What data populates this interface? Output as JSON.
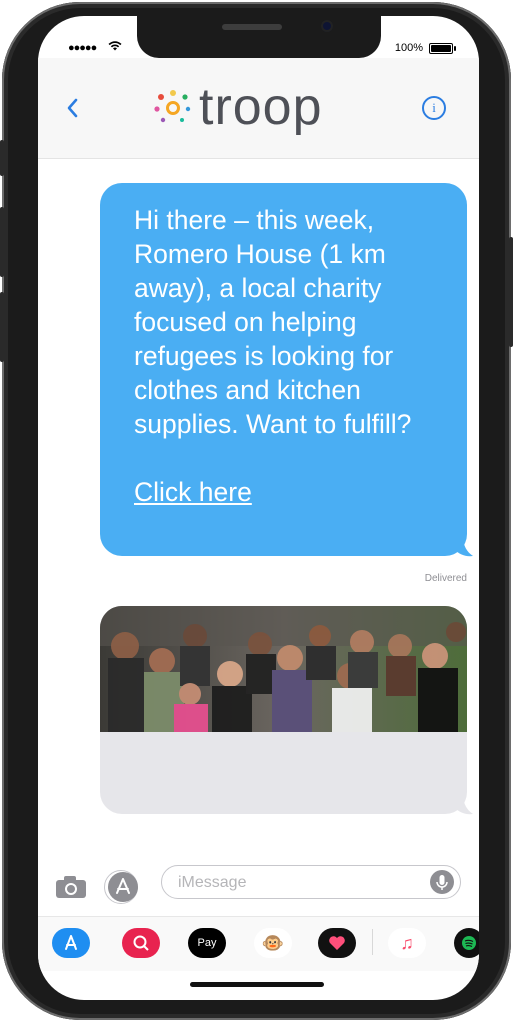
{
  "status_bar": {
    "signal": "●●●●●",
    "battery_percent": "100%"
  },
  "header": {
    "back_icon": "chevron-left-icon",
    "logo_text": "troop",
    "info_icon": "info-icon",
    "info_glyph": "i",
    "accent_color": "#2b7de1"
  },
  "messages": {
    "outgoing_text": "Hi there – this week, Romero House (1 km away), a local charity focused on helping refugees is looking for clothes and kitchen supplies. Want to fulfill?",
    "outgoing_link": "Click here",
    "bubble_color": "#4aaef3",
    "delivered_label": "Delivered"
  },
  "input": {
    "placeholder": "iMessage",
    "camera_icon": "camera-icon",
    "apps_icon": "app-store-icon",
    "mic_icon": "microphone-icon"
  },
  "drawer": {
    "apps": [
      {
        "icon": "app-store-icon",
        "label": "A",
        "color": "#1f8ef1"
      },
      {
        "icon": "search-images-icon",
        "label": "",
        "color": "#e8234f"
      },
      {
        "icon": "apple-pay-icon",
        "label": "Pay",
        "color": "#000000"
      },
      {
        "icon": "animoji-monkey-icon",
        "label": "🐵",
        "color": "#ffffff"
      },
      {
        "icon": "digital-touch-icon",
        "label": "",
        "color": "#111111"
      },
      {
        "icon": "music-icon",
        "label": "♫",
        "color": "#ffffff"
      },
      {
        "icon": "spotify-icon",
        "label": "",
        "color": "#111111"
      }
    ]
  }
}
